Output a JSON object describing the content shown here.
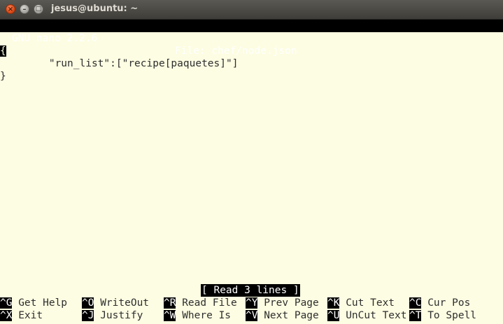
{
  "window": {
    "title": "jesus@ubuntu: ~",
    "close_glyph": "×",
    "min_glyph": "–",
    "max_glyph": "□"
  },
  "nano": {
    "version": "GNU nano 2.2.6",
    "file_label": "File: chef/node.json",
    "lines": [
      "{",
      "        \"run_list\":[\"recipe[paquetes]\"]",
      "}"
    ],
    "status": "[ Read 3 lines ]"
  },
  "shortcuts": {
    "row1": [
      {
        "key": "^G",
        "label": " Get Help"
      },
      {
        "key": "^O",
        "label": " WriteOut"
      },
      {
        "key": "^R",
        "label": " Read File"
      },
      {
        "key": "^Y",
        "label": " Prev Page"
      },
      {
        "key": "^K",
        "label": " Cut Text"
      },
      {
        "key": "^C",
        "label": " Cur Pos"
      }
    ],
    "row2": [
      {
        "key": "^X",
        "label": " Exit"
      },
      {
        "key": "^J",
        "label": " Justify"
      },
      {
        "key": "^W",
        "label": " Where Is"
      },
      {
        "key": "^V",
        "label": " Next Page"
      },
      {
        "key": "^U",
        "label": " UnCut Text"
      },
      {
        "key": "^T",
        "label": " To Spell"
      }
    ]
  }
}
